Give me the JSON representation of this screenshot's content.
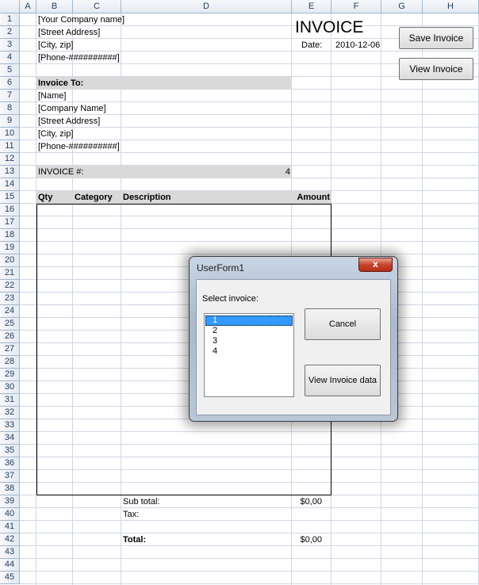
{
  "sheet": {
    "columns": [
      "A",
      "B",
      "C",
      "D",
      "E",
      "F",
      "G",
      "H"
    ],
    "rows": [
      "1",
      "2",
      "3",
      "4",
      "5",
      "6",
      "7",
      "8",
      "9",
      "10",
      "11",
      "12",
      "13",
      "14",
      "15",
      "16",
      "17",
      "18",
      "19",
      "20",
      "21",
      "22",
      "23",
      "24",
      "25",
      "26",
      "27",
      "28",
      "29",
      "30",
      "31",
      "32",
      "33",
      "34",
      "35",
      "36",
      "37",
      "38",
      "39",
      "40",
      "41",
      "42",
      "43",
      "44",
      "45"
    ]
  },
  "company": {
    "name": "[Your Company name]",
    "street": "[Street Address]",
    "city": "[City, zip]",
    "phone": "[Phone-##########]"
  },
  "invoice": {
    "title": "INVOICE",
    "date_label": "Date:",
    "date_value": "2010-12-06",
    "number_label": "INVOICE #:",
    "number_value": "4"
  },
  "bill_to": {
    "label": "Invoice To:",
    "name": "[Name]",
    "company": "[Company Name]",
    "street": "[Street Address]",
    "city": "[City, zip]",
    "phone": "[Phone-##########]"
  },
  "table": {
    "headers": {
      "qty": "Qty",
      "category": "Category",
      "description": "Description",
      "amount": "Amount"
    }
  },
  "totals": {
    "subtotal_label": "Sub total:",
    "subtotal_value": "$0,00",
    "tax_label": "Tax:",
    "total_label": "Total:",
    "total_value": "$0,00"
  },
  "buttons": {
    "save_invoice": "Save Invoice",
    "view_invoice": "View Invoice"
  },
  "dialog": {
    "title": "UserForm1",
    "close": "x",
    "select_label": "Select invoice:",
    "items": [
      "1",
      "2",
      "3",
      "4"
    ],
    "selected_index": 0,
    "cancel": "Cancel",
    "view_data": "View Invoice data"
  }
}
